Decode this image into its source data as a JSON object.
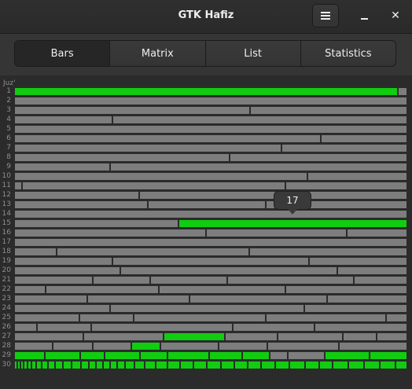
{
  "app": {
    "title": "GTK Hafiz"
  },
  "colors": {
    "unmemorized": "#7d7d7d",
    "memorized": "#11cc11",
    "background": "#2b2b2b"
  },
  "tabs": [
    {
      "label": "Bars",
      "active": true
    },
    {
      "label": "Matrix",
      "active": false
    },
    {
      "label": "List",
      "active": false
    },
    {
      "label": "Statistics",
      "active": false
    }
  ],
  "chart": {
    "axis_label": "Juz'",
    "tooltip": "17"
  },
  "chart_data": {
    "type": "bar",
    "ylabel": "Juz'",
    "categories": [
      "1",
      "2",
      "3",
      "4",
      "5",
      "6",
      "7",
      "8",
      "9",
      "10",
      "11",
      "12",
      "13",
      "14",
      "15",
      "16",
      "17",
      "18",
      "19",
      "20",
      "21",
      "22",
      "23",
      "24",
      "25",
      "26",
      "27",
      "28",
      "29",
      "30"
    ],
    "rows": [
      [
        [
          0.976,
          1,
          1
        ]
      ],
      [],
      [
        [
          0.6,
          0
        ]
      ],
      [
        [
          0.25,
          0
        ]
      ],
      [],
      [
        [
          0.78,
          0
        ]
      ],
      [
        [
          0.68,
          0
        ]
      ],
      [
        [
          0.547,
          0
        ]
      ],
      [
        [
          0.243,
          0
        ]
      ],
      [
        [
          0.745,
          0
        ]
      ],
      [
        [
          0.02,
          0
        ],
        [
          0.69,
          0
        ]
      ],
      [
        [
          0.317,
          0
        ],
        [
          0.69,
          0
        ]
      ],
      [
        [
          0.34,
          0
        ],
        [
          0.64,
          0
        ]
      ],
      [],
      [
        [
          0.418,
          0
        ],
        [
          1,
          1
        ]
      ],
      [
        [
          0.487,
          0
        ],
        [
          0.845,
          0
        ]
      ],
      [],
      [
        [
          0.107,
          0
        ],
        [
          0.597,
          0
        ]
      ],
      [
        [
          0.249,
          0
        ],
        [
          0.75,
          0
        ]
      ],
      [
        [
          0.27,
          0
        ],
        [
          0.822,
          0
        ]
      ],
      [
        [
          0.2,
          0
        ],
        [
          0.345,
          0
        ],
        [
          0.541,
          0
        ],
        [
          0.863,
          0
        ]
      ],
      [
        [
          0.08,
          0
        ],
        [
          0.368,
          0
        ],
        [
          0.69,
          0
        ]
      ],
      [
        [
          0.185,
          0
        ],
        [
          0.445,
          0
        ],
        [
          0.796,
          0
        ]
      ],
      [
        [
          0.243,
          0
        ],
        [
          0.738,
          0
        ]
      ],
      [
        [
          0.165,
          0
        ],
        [
          0.304,
          0
        ],
        [
          0.64,
          0
        ],
        [
          0.945,
          0
        ]
      ],
      [
        [
          0.057,
          0
        ],
        [
          0.195,
          0
        ],
        [
          0.556,
          0
        ],
        [
          0.763,
          0
        ]
      ],
      [
        [
          0.175,
          0
        ],
        [
          0.38,
          0
        ],
        [
          0.535,
          1
        ],
        [
          0.669,
          0
        ],
        [
          0.835,
          0
        ],
        [
          0.922,
          0
        ]
      ],
      [
        [
          0.097,
          0
        ],
        [
          0.2,
          0
        ],
        [
          0.298,
          0
        ],
        [
          0.371,
          1
        ],
        [
          0.52,
          0
        ],
        [
          0.643,
          0
        ],
        [
          0.825,
          0
        ]
      ],
      [
        [
          0.078,
          1
        ],
        [
          0.167,
          1
        ],
        [
          0.229,
          1
        ],
        [
          0.32,
          1
        ],
        [
          0.389,
          1
        ],
        [
          0.495,
          1
        ],
        [
          0.58,
          1
        ],
        [
          0.65,
          1
        ],
        [
          0.696,
          0
        ],
        [
          0.79,
          0
        ],
        [
          0.904,
          1
        ],
        [
          1,
          1
        ]
      ],
      [
        [
          0.008,
          1
        ],
        [
          0.016,
          1
        ],
        [
          0.024,
          1
        ],
        [
          0.034,
          1
        ],
        [
          0.044,
          1
        ],
        [
          0.056,
          1
        ],
        [
          0.07,
          1
        ],
        [
          0.086,
          1
        ],
        [
          0.104,
          1
        ],
        [
          0.124,
          1
        ],
        [
          0.146,
          1
        ],
        [
          0.17,
          1
        ],
        [
          0.19,
          1
        ],
        [
          0.208,
          1
        ],
        [
          0.226,
          1
        ],
        [
          0.244,
          1
        ],
        [
          0.262,
          1
        ],
        [
          0.282,
          1
        ],
        [
          0.306,
          1
        ],
        [
          0.332,
          1
        ],
        [
          0.36,
          1
        ],
        [
          0.39,
          1
        ],
        [
          0.422,
          1
        ],
        [
          0.456,
          1
        ],
        [
          0.49,
          1
        ],
        [
          0.525,
          1
        ],
        [
          0.56,
          1
        ],
        [
          0.594,
          1
        ],
        [
          0.628,
          1
        ],
        [
          0.664,
          1
        ],
        [
          0.7,
          1
        ],
        [
          0.74,
          1
        ],
        [
          0.775,
          1
        ],
        [
          0.81,
          1
        ],
        [
          0.85,
          1
        ],
        [
          0.89,
          1
        ],
        [
          0.93,
          1
        ],
        [
          0.97,
          1
        ],
        [
          1,
          1
        ]
      ]
    ]
  }
}
